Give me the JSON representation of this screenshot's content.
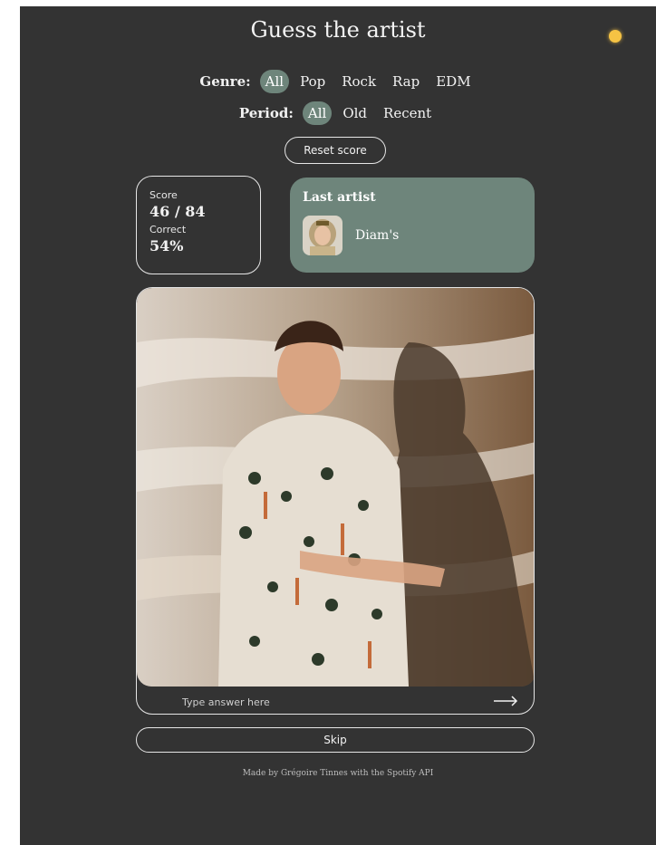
{
  "header": {
    "title": "Guess the artist",
    "theme_icon": "sun-icon"
  },
  "filters": {
    "genre_label": "Genre:",
    "genres": [
      "All",
      "Pop",
      "Rock",
      "Rap",
      "EDM"
    ],
    "genre_selected": "All",
    "period_label": "Period:",
    "periods": [
      "All",
      "Old",
      "Recent"
    ],
    "period_selected": "All"
  },
  "reset_label": "Reset score",
  "score": {
    "score_label": "Score",
    "score_value": "46 / 84",
    "correct_label": "Correct",
    "correct_value": "54%"
  },
  "last_artist": {
    "title": "Last artist",
    "name": "Diam's"
  },
  "answer": {
    "placeholder": "Type answer here",
    "submit_icon": "arrow-right-icon"
  },
  "skip_label": "Skip",
  "footer": "Made by Grégoire Tinnes with the Spotify API",
  "colors": {
    "background": "#333333",
    "accent": "#6e857b",
    "sun": "#f6c344"
  }
}
